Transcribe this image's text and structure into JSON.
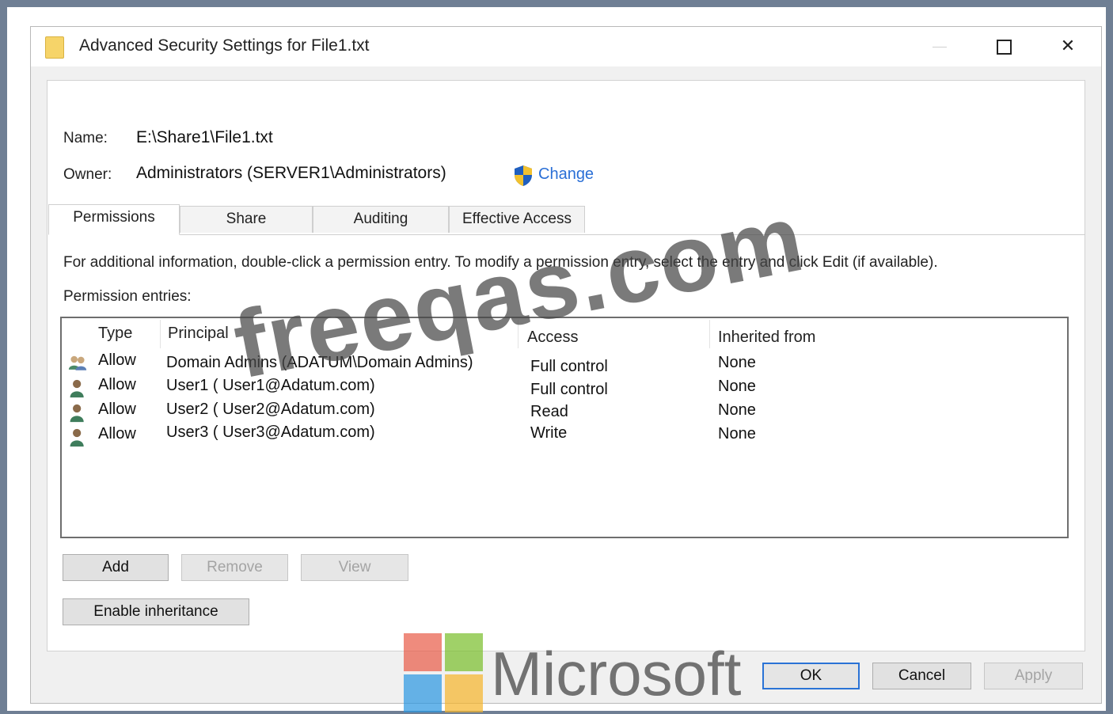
{
  "window": {
    "title": "Advanced Security Settings for File1.txt",
    "icon": "folder-icon",
    "controls": {
      "minimize": "minimize-icon",
      "maximize": "maximize-icon",
      "close_symbol": "✕"
    }
  },
  "details": {
    "name_label": "Name:",
    "name_value": "E:\\Share1\\File1.txt",
    "owner_label": "Owner:",
    "owner_value": "Administrators (SERVER1\\Administrators)",
    "change_link": "Change",
    "change_icon": "shield-icon"
  },
  "tabs": [
    {
      "label": "Permissions",
      "active": true
    },
    {
      "label": "Share",
      "active": false
    },
    {
      "label": "Auditing",
      "active": false
    },
    {
      "label": "Effective Access",
      "active": false
    }
  ],
  "info_text": "For additional information, double-click a permission entry. To modify a permission entry, select the entry and click Edit (if available).",
  "entries_label": "Permission entries:",
  "table": {
    "headers": {
      "type": "Type",
      "principal": "Principal",
      "access": "Access",
      "inherited": "Inherited from"
    },
    "rows": [
      {
        "icon": "group-icon",
        "type": "Allow",
        "principal": "Domain Admins (ADATUM\\Domain Admins)",
        "access": "Full control",
        "inherited": "None"
      },
      {
        "icon": "user-icon",
        "type": "Allow",
        "principal": "User1 ( User1@Adatum.com)",
        "access": "Full control",
        "inherited": "None"
      },
      {
        "icon": "user-icon",
        "type": "Allow",
        "principal": "User2 ( User2@Adatum.com)",
        "access": "Read",
        "inherited": "None"
      },
      {
        "icon": "user-icon",
        "type": "Allow",
        "principal": "User3 ( User3@Adatum.com)",
        "access": "Write",
        "inherited": "None"
      }
    ]
  },
  "buttons": {
    "add": "Add",
    "remove": "Remove",
    "view": "View",
    "enable_inheritance": "Enable inheritance",
    "ok": "OK",
    "cancel": "Cancel",
    "apply": "Apply"
  },
  "overlays": {
    "watermark_text": "freeqas.com",
    "brand_text": "Microsoft",
    "brand_colors": [
      "#f25022",
      "#7fba00",
      "#00a4ef",
      "#ffb900"
    ]
  },
  "colors": {
    "link": "#2a6fd6",
    "frame": "#6f7f94",
    "default_button_border": "#2a73d6"
  }
}
